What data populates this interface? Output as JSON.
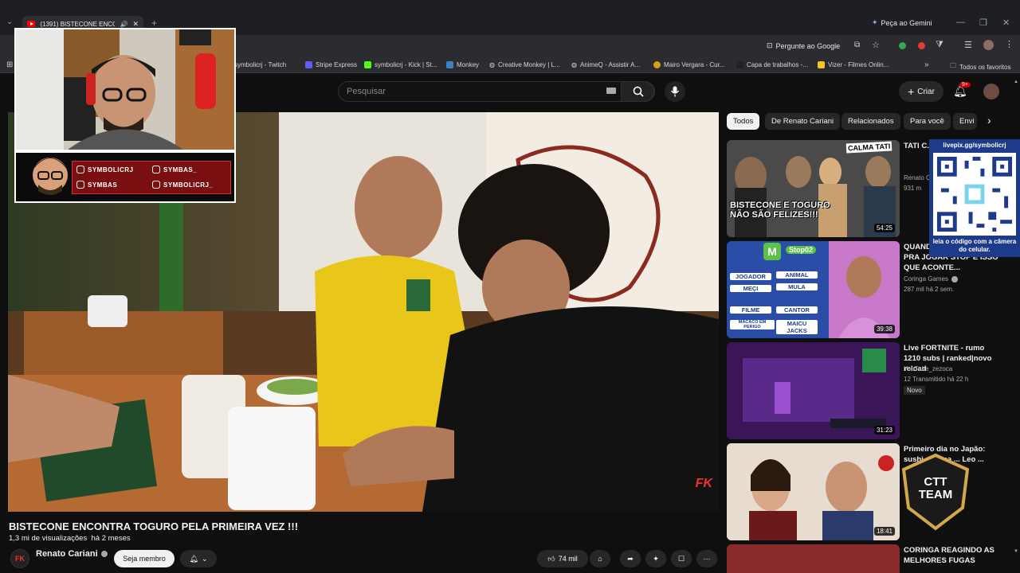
{
  "browser": {
    "tab_title": "(1391) BISTECONE ENCONT",
    "gemini_button": "Peça ao Gemini",
    "ask_google": "Pergunte ao Google",
    "bookmarks": [
      "symbolicrj - Twitch",
      "Stripe Express",
      "symbolicrj - Kick | St...",
      "Monkey",
      "Creative Monkey | L...",
      "AnimeQ - Assistir A...",
      "Mairo Vergara - Cur...",
      "Capa de trabalhos -...",
      "Vizer - Filmes Onlin..."
    ],
    "all_favorites": "Todos os favoritos"
  },
  "youtube": {
    "search_placeholder": "Pesquisar",
    "create_label": "Criar",
    "notif_badge": "9+"
  },
  "overlay": {
    "socials": [
      "SYMBOLICRJ",
      "SYMBAS_",
      "SYMBAS",
      "SYMBOLICRJ_"
    ],
    "qr_url": "livepix.gg/symbolicrj",
    "qr_caption": "leia o código com a câmera do celular."
  },
  "video": {
    "watermark": "FK",
    "title": "BISTECONE ENCONTRA TOGURO PELA PRIMEIRA VEZ !!!",
    "views": "1,3 mi de visualizações",
    "age": "há 2 meses",
    "channel": "Renato Cariani",
    "join_button": "Seja membro",
    "likes": "74 mil"
  },
  "chips": [
    "Todos",
    "De Renato Cariani",
    "Relacionados",
    "Para você",
    "Envi"
  ],
  "recommendations": [
    {
      "title": "TATI C... BISTEC... CLIMA",
      "thumb_text": "BISTECONE E TOGURO NÃO SÃO FELIZES!!!",
      "thumb_badge": "CALMA TATI",
      "channel": "Renato C",
      "meta": "931 m",
      "duration": "54:25"
    },
    {
      "title": "QUANDO ... OS AMIGOS PRA JOGAR STOP E ISSO QUE ACONTE...",
      "channel": "Coringa Games",
      "meta": "287 mil  há 2 sem.",
      "duration": "39:38",
      "stop_words": [
        "JOGADOR",
        "ANIMAL",
        "MEÇI",
        "MULA",
        "FILME",
        "CANTOR",
        "MACACO EM PERIGO",
        "MAICU JACKS"
      ],
      "stop_label": "Stop02"
    },
    {
      "title": "Live FORTNITE - rumo 1210 subs | ranked|novo reload",
      "channel": "YouTube_zezoca",
      "meta": "12  Transmitido há 22 h",
      "badge": "Novo",
      "duration": "31:23"
    },
    {
      "title": "Primeiro dia no Japão: sushi, ... uma ... Leo ...",
      "duration": "18:41",
      "logo_text": "CTT TEAM"
    },
    {
      "title": "CORINGA REAGINDO AS MELHORES FUGAS"
    }
  ]
}
